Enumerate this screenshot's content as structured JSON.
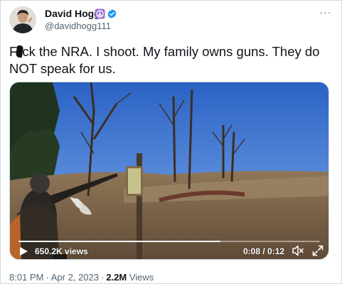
{
  "author": {
    "display_name": "David Hogg",
    "handle": "@davidhogg111",
    "verified": true,
    "badge_icon": "peace-sign-icon",
    "badge_color": "#9b6ad6",
    "verified_color": "#1d9bf0"
  },
  "more_label": "···",
  "tweet": {
    "text_prefix": "F",
    "text_rest": "ck the NRA. I shoot. My family owns guns. They do NOT speak for us."
  },
  "video": {
    "views": "650.2K views",
    "time": "0:08 / 0:12",
    "progress": 0.67
  },
  "meta": {
    "time": "8:01 PM",
    "date": "Apr 2, 2023",
    "separator": "·",
    "views_count": "2.2M",
    "views_label": "Views"
  },
  "colors": {
    "text": "#0f1419",
    "secondary": "#536471",
    "border": "#cfd9de"
  }
}
